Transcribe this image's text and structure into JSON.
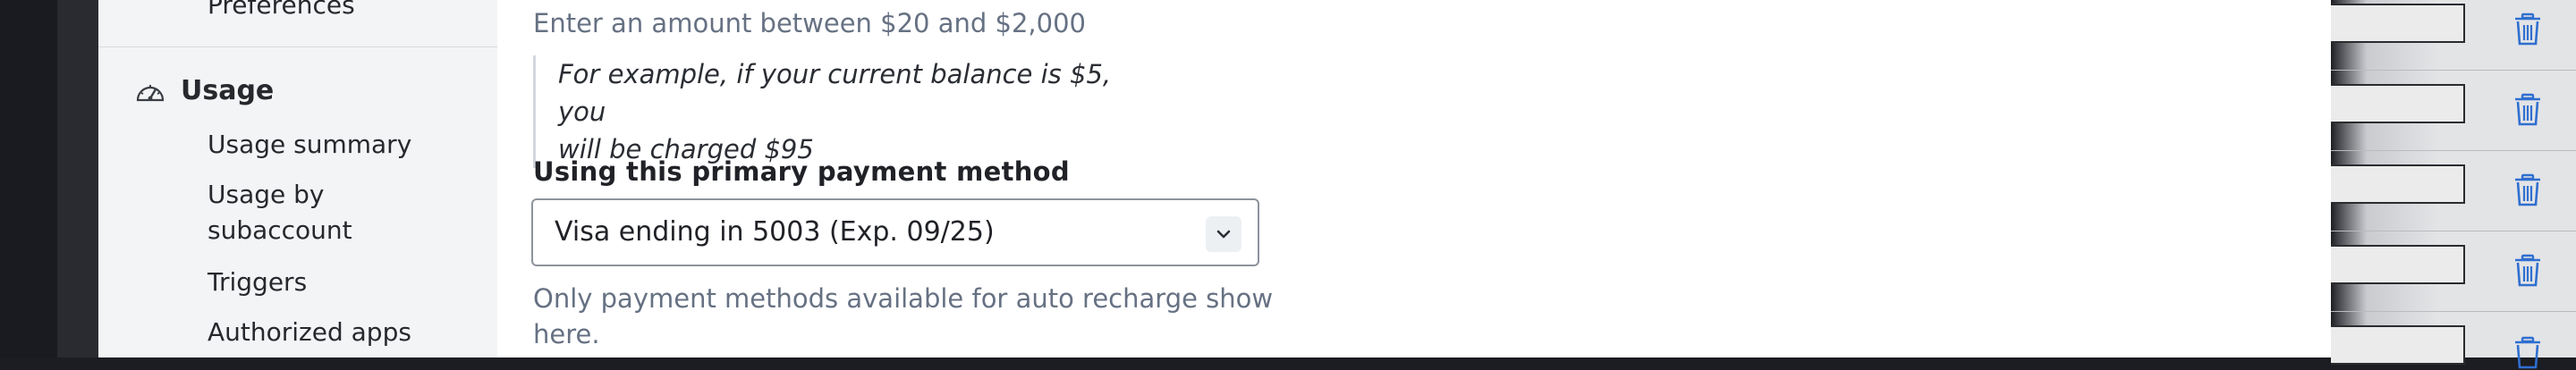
{
  "sidebar": {
    "top_item": "Preferences",
    "section": {
      "label": "Usage",
      "icon": "gauge-icon"
    },
    "items": [
      {
        "label": "Usage summary"
      },
      {
        "label": "Usage by subaccount",
        "line1": "Usage by",
        "line2": "subaccount"
      },
      {
        "label": "Triggers"
      },
      {
        "label": "Authorized apps"
      }
    ]
  },
  "form": {
    "amount_hint": "Enter an amount between $20 and $2,000",
    "example_line1": "For example, if your current balance is $5, you",
    "example_line2": "will be charged $95",
    "payment_label": "Using this primary payment method",
    "payment_selected": "Visa ending in 5003 (Exp. 09/25)",
    "payment_note_line1": "Only payment methods available for auto recharge show",
    "payment_note_line2": "here."
  },
  "table": {
    "delete_icon": "trash-icon",
    "rows": 5
  },
  "colors": {
    "accent_blue": "#2f6fd0",
    "muted_text": "#667183",
    "sidebar_bg": "#f3f4f6"
  }
}
